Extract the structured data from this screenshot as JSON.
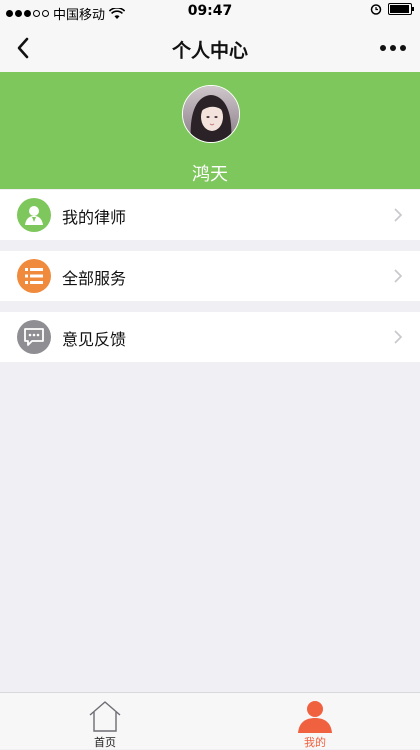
{
  "status_bar": {
    "carrier": "中国移动",
    "time": "09:47",
    "battery_level": 0.85
  },
  "nav": {
    "title": "个人中心",
    "back_icon": "chevron-left-icon",
    "more_icon": "more-dots-icon"
  },
  "profile": {
    "name": "鸿天",
    "banner_color": "#7ec75c"
  },
  "menu": [
    {
      "label": "我的律师",
      "icon": "lawyer-icon",
      "icon_color": "#7ec75c"
    },
    {
      "label": "全部服务",
      "icon": "list-icon",
      "icon_color": "#f08a3c"
    },
    {
      "label": "意见反馈",
      "icon": "feedback-icon",
      "icon_color": "#8e8e93"
    }
  ],
  "tabs": [
    {
      "label": "首页",
      "icon": "home-icon",
      "active": false
    },
    {
      "label": "我的",
      "icon": "user-icon",
      "active": true,
      "active_color": "#f0613f"
    }
  ]
}
